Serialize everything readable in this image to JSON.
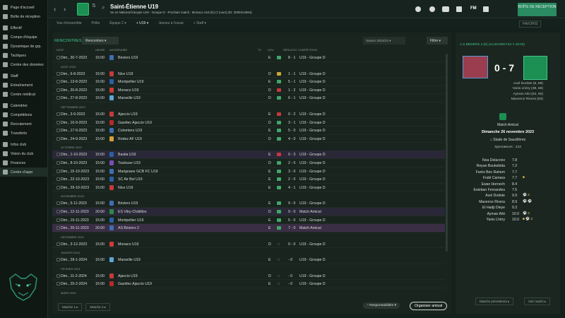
{
  "sidebar": {
    "items": [
      {
        "label": "Page d'accueil",
        "icon": "home-icon"
      },
      {
        "label": "Boîte de réception",
        "icon": "inbox-icon"
      },
      {
        "label": "Effectif",
        "icon": "squad-icon"
      },
      {
        "label": "Compo d'équipe",
        "icon": "lineup-icon"
      },
      {
        "label": "Dynamique de grp.",
        "icon": "dynamics-icon"
      },
      {
        "label": "Tactiques",
        "icon": "tactics-icon"
      },
      {
        "label": "Centre des données",
        "icon": "data-icon"
      },
      {
        "label": "Staff",
        "icon": "staff-icon"
      },
      {
        "label": "Entraînement",
        "icon": "training-icon"
      },
      {
        "label": "Centre médical",
        "icon": "medical-icon"
      },
      {
        "label": "Calendrier",
        "icon": "calendar-icon"
      },
      {
        "label": "Compétitions",
        "icon": "trophy-icon"
      },
      {
        "label": "Recrutement",
        "icon": "scouting-icon"
      },
      {
        "label": "Transferts",
        "icon": "transfer-icon"
      },
      {
        "label": "Infos club",
        "icon": "club-info-icon"
      },
      {
        "label": "Vision du club",
        "icon": "vision-icon"
      },
      {
        "label": "Finances",
        "icon": "finance-icon"
      },
      {
        "label": "Centre d'appr.",
        "icon": "academy-icon"
      }
    ]
  },
  "header": {
    "title": "Saint-Étienne U19",
    "subtitle": "Se en National français U19 - Groupe D - Prochain match : Monaco U19 (D) (7 jours) (ID: 2000314894)",
    "inbox_button": "BOÎTE DE RÉCEPTION",
    "fm_label": "FM",
    "fav_label": "FAVORIS"
  },
  "subnav": [
    "Vue d'ensemble",
    "Prêts",
    "Équipe 2 ▾",
    "+ U19 ▾",
    "Jeunes à l'essai",
    "+ Staff ▾"
  ],
  "fixtures": {
    "section_title": "RENCONTRES",
    "dropdown": "Rencontres",
    "season": "Saison 2023/24",
    "filter": "Filtre",
    "columns": {
      "date": "DATE",
      "heure": "HEURE",
      "adversaire": "ADVERSAIRE",
      "tv": "TV",
      "lieu": "LIEU",
      "resultat": "RÉSULTAT",
      "competition": "COMPÉTITION"
    },
    "rows": [
      {
        "type": "match",
        "date": "Dim., 30-7-2023",
        "time": "15:00",
        "opp": "Béziers U19",
        "lieu": "E",
        "res": "8 - 1",
        "comp": "U19 - Groupe D",
        "crest": "#3d6fb2",
        "resc": "#3fa868"
      },
      {
        "type": "month",
        "label": "AOÛT 2023"
      },
      {
        "type": "match",
        "date": "Dim., 6-8-2023",
        "time": "15:00",
        "opp": "Nice U19",
        "lieu": "D",
        "res": "1 - 1",
        "comp": "U19 - Groupe D",
        "crest": "#c43a3a",
        "resc": "#c9a83a"
      },
      {
        "type": "match",
        "date": "Dim., 13-8-2023",
        "time": "15:00",
        "opp": "Montpellier U19",
        "lieu": "E",
        "res": "5 - 1",
        "comp": "U19 - Groupe D",
        "crest": "#2b5fa8",
        "resc": "#3fa868"
      },
      {
        "type": "match",
        "date": "Dim., 20-8-2023",
        "time": "15:00",
        "opp": "Monaco U19",
        "lieu": "D",
        "res": "1 - 2",
        "comp": "U19 - Groupe D",
        "crest": "#d23a3a",
        "resc": "#c43a3a"
      },
      {
        "type": "match",
        "date": "Dim., 27-8-2023",
        "time": "15:00",
        "opp": "Marseille U19",
        "lieu": "D",
        "res": "6 - 1",
        "comp": "U19 - Groupe D",
        "crest": "#5aa7d8",
        "resc": "#3fa868"
      },
      {
        "type": "month",
        "label": "SEPTEMBRE 2023"
      },
      {
        "type": "match",
        "date": "Dim., 3-9-2023",
        "time": "15:00",
        "opp": "Ajaccio U19",
        "lieu": "E",
        "res": "0 - 2",
        "comp": "U19 - Groupe D",
        "crest": "#c43a3a",
        "resc": "#c43a3a"
      },
      {
        "type": "match",
        "date": "Dim., 10-9-2023",
        "time": "15:00",
        "opp": "Gazélec Ajaccio U19",
        "lieu": "D",
        "res": "3 - 1",
        "comp": "U19 - Groupe D",
        "crest": "#b52a2a",
        "resc": "#3fa868"
      },
      {
        "type": "match",
        "date": "Dim., 17-9-2023",
        "time": "15:00",
        "opp": "Colomiers U19",
        "lieu": "E",
        "res": "5 - 0",
        "comp": "U19 - Groupe D",
        "crest": "#3d6fb2",
        "resc": "#3fa868"
      },
      {
        "type": "match",
        "date": "Dim., 24-9-2023",
        "time": "15:00",
        "opp": "Rodez AF U19",
        "lieu": "D",
        "res": "4 - 0",
        "comp": "U19 - Groupe D",
        "crest": "#d8a03a",
        "resc": "#3fa868"
      },
      {
        "type": "month",
        "label": "OCTOBRE 2023"
      },
      {
        "type": "match",
        "date": "Dim., 1-10-2023",
        "time": "15:00",
        "opp": "Bastia U19",
        "lieu": "E",
        "res": "0 - 3",
        "comp": "U19 - Groupe D",
        "crest": "#2b5fa8",
        "resc": "#c43a3a",
        "hl": "hl"
      },
      {
        "type": "match",
        "date": "Dim., 8-10-2023",
        "time": "15:00",
        "opp": "Toulouse U19",
        "lieu": "D",
        "res": "2 - 0",
        "comp": "U19 - Groupe D",
        "crest": "#7a4fb2",
        "resc": "#3fa868"
      },
      {
        "type": "match",
        "date": "Dim., 15-10-2023",
        "time": "15:00",
        "opp": "Marignane GCB FC U19",
        "lieu": "E",
        "res": "3 - 0",
        "comp": "U19 - Groupe D",
        "crest": "#3d6fb2",
        "resc": "#3fa868"
      },
      {
        "type": "match",
        "date": "Dim., 22-10-2023",
        "time": "15:00",
        "opp": "SC Air Bel U19",
        "lieu": "E",
        "res": "2 - 0",
        "comp": "U19 - Groupe D",
        "crest": "#2b5fa8",
        "resc": "#3fa868"
      },
      {
        "type": "match",
        "date": "Dim., 29-10-2023",
        "time": "15:00",
        "opp": "Nice U19",
        "lieu": "E",
        "res": "4 - 1",
        "comp": "U19 - Groupe D",
        "crest": "#c43a3a",
        "resc": "#3fa868"
      },
      {
        "type": "month",
        "label": "NOVEMBRE 2023"
      },
      {
        "type": "match",
        "date": "Dim., 5-11-2023",
        "time": "15:00",
        "opp": "Béziers U19",
        "lieu": "E",
        "res": "9 - 0",
        "comp": "U19 - Groupe D",
        "crest": "#3d6fb2",
        "resc": "#3fa868"
      },
      {
        "type": "match",
        "date": "Dim., 12-11-2023",
        "time": "20:00",
        "opp": "ES Vitry-Châtillon",
        "lieu": "D",
        "res": "9 - 0",
        "comp": "Match Amical",
        "crest": "#2b8a4a",
        "resc": "#3fa868",
        "hl": "hl"
      },
      {
        "type": "match",
        "date": "Dim., 19-11-2023",
        "time": "15:00",
        "opp": "Montpellier U19",
        "lieu": "E",
        "res": "5 - 0",
        "comp": "U19 - Groupe D",
        "crest": "#2b5fa8",
        "resc": "#3fa868"
      },
      {
        "type": "match",
        "date": "Dim., 26-11-2023",
        "time": "20:00",
        "opp": "AS Béziers 2",
        "lieu": "E",
        "res": "7 - 0",
        "comp": "Match Amical",
        "crest": "#3d6fb2",
        "resc": "#3fa868",
        "hl": "hl2"
      },
      {
        "type": "month",
        "label": "DÉCEMBRE 2023"
      },
      {
        "type": "match",
        "date": "Dim., 3-12-2023",
        "time": "15:00",
        "opp": "Monaco U19",
        "lieu": "D",
        "res": "0 - 0",
        "comp": "U19 - Groupe D",
        "crest": "#d23a3a",
        "resc": ""
      },
      {
        "type": "month",
        "label": "JANVIER 2024"
      },
      {
        "type": "match",
        "date": "Dim., 28-1-2024",
        "time": "15:00",
        "opp": "Marseille U19",
        "lieu": "E",
        "res": "- 0",
        "comp": "U19 - Groupe D",
        "crest": "#5aa7d8",
        "resc": ""
      },
      {
        "type": "month",
        "label": "FÉVRIER 2024"
      },
      {
        "type": "match",
        "date": "Dim., 11-2-2024",
        "time": "15:00",
        "opp": "Ajaccio U19",
        "lieu": "D",
        "res": "- 0",
        "comp": "U19 - Groupe D",
        "crest": "#c43a3a",
        "resc": ""
      },
      {
        "type": "match",
        "date": "Dim., 25-2-2024",
        "time": "15:00",
        "opp": "Gazélec Ajaccio U19",
        "lieu": "E",
        "res": "- 0",
        "comp": "U19 - Groupe D",
        "crest": "#b52a2a",
        "resc": ""
      },
      {
        "type": "month",
        "label": "MARS 2024"
      }
    ],
    "bottom_buttons": [
      "Matche 1 ▸",
      "Matche 2 ▸"
    ],
    "resp_button": "Responsabilités",
    "organize_button": "Organiser amical"
  },
  "match_detail": {
    "header": "A.S BÉZIERS 2 (E) (AUJOURD'HUI À 20:00)",
    "score": "0 - 7",
    "scorers": [
      "Axel Dodote (5, 89)",
      "Yanis Lhéry (38, 68)",
      "Ayman Aïki (52, 60)",
      "Maxence Rivera (83)"
    ],
    "type": "Match Amical",
    "date": "Dimanche 26 novembre 2023",
    "stadium": "Stade de Saucillères",
    "spectators": "Spectateurs : 223",
    "ratings": [
      {
        "name": "Noa Delacroix",
        "rating": "7.8",
        "ev": ""
      },
      {
        "name": "Reyan Boukebida",
        "rating": "7.2",
        "ev": ""
      },
      {
        "name": "Farès Ben Rahem",
        "rating": "7.7",
        "ev": ""
      },
      {
        "name": "Fodé Camara",
        "rating": "7.7",
        "ev": "■"
      },
      {
        "name": "Ewan Hornech",
        "rating": "8.4",
        "ev": ""
      },
      {
        "name": "Esteban Fernandes",
        "rating": "7.5",
        "ev": ""
      },
      {
        "name": "Axel Dodote",
        "rating": "9.9",
        "ev": "⚽ 2"
      },
      {
        "name": "Maxence Rivera",
        "rating": "8.9",
        "ev": "⚽ ⚽"
      },
      {
        "name": "El Hadji Dieye",
        "rating": "9.3",
        "ev": ""
      },
      {
        "name": "Ayman Aïki",
        "rating": "10.0",
        "ev": "⚽ 2"
      },
      {
        "name": "Yanis Lhéry",
        "rating": "10.0",
        "ev": "■ ⚽ 2"
      }
    ],
    "prev_button": "Matchs précédents ▸",
    "view_button": "Voir match ▸"
  }
}
